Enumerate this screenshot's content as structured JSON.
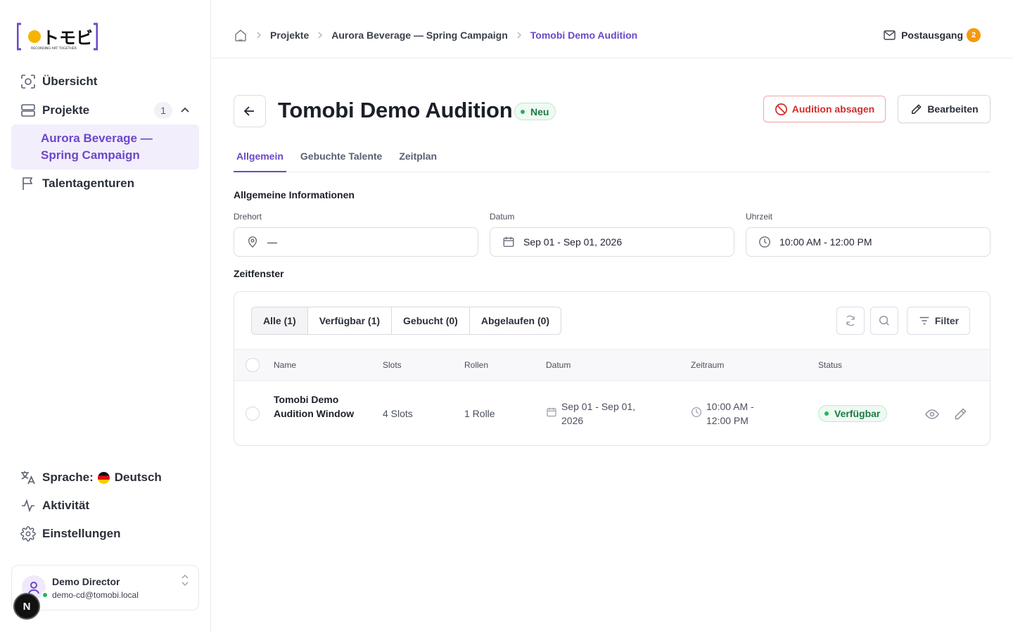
{
  "app": {
    "logo_text": "トモビ",
    "logo_tagline": "RECORDING ART TOGETHER",
    "accent_color": "#6c47c9"
  },
  "sidebar": {
    "nav": [
      {
        "label": "Übersicht",
        "icon": "overview-icon"
      },
      {
        "label": "Projekte",
        "icon": "projects-icon",
        "count": "1"
      },
      {
        "label": "Talentagenturen",
        "icon": "flag-icon"
      }
    ],
    "sub_item": "Aurora Beverage — Spring Campaign",
    "bottom": {
      "language_label": "Sprache:",
      "language_value": "Deutsch",
      "activity": "Aktivität",
      "settings": "Einstellungen"
    },
    "user": {
      "name": "Demo Director",
      "email": "demo-cd@tomobi.local"
    },
    "n_badge": "N"
  },
  "topbar": {
    "breadcrumbs": [
      "Projekte",
      "Aurora Beverage — Spring Campaign",
      "Tomobi Demo Audition"
    ],
    "outbox_label": "Postausgang",
    "outbox_count": "2"
  },
  "page": {
    "title": "Tomobi Demo Audition",
    "status": "Neu",
    "cancel_button": "Audition absagen",
    "edit_button": "Bearbeiten",
    "tabs": [
      "Allgemein",
      "Gebuchte Talente",
      "Zeitplan"
    ],
    "general_section": "Allgemeine Informationen",
    "fields": {
      "location": {
        "label": "Drehort",
        "value": "—"
      },
      "date": {
        "label": "Datum",
        "value": "Sep 01 - Sep 01, 2026"
      },
      "time": {
        "label": "Uhrzeit",
        "value": "10:00 AM - 12:00 PM"
      }
    },
    "windows_section": "Zeitfenster",
    "segments": [
      "Alle (1)",
      "Verfügbar (1)",
      "Gebucht (0)",
      "Abgelaufen (0)"
    ],
    "filter_button": "Filter",
    "table": {
      "columns": [
        "Name",
        "Slots",
        "Rollen",
        "Datum",
        "Zeitraum",
        "Status"
      ],
      "rows": [
        {
          "name": "Tomobi Demo Audition Window",
          "slots": "4 Slots",
          "roles": "1 Rolle",
          "date": "Sep 01 - Sep 01, 2026",
          "time": "10:00 AM - 12:00 PM",
          "status": "Verfügbar"
        }
      ]
    }
  }
}
